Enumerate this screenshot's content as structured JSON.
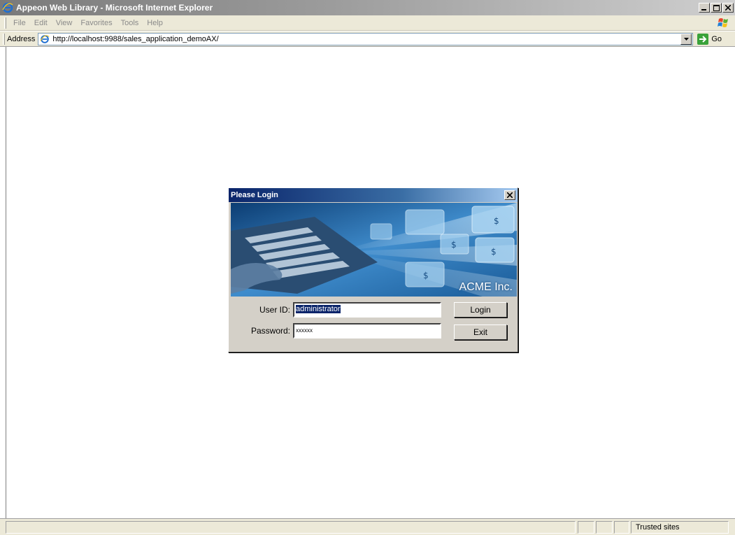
{
  "window": {
    "title": "Appeon Web Library - Microsoft Internet Explorer"
  },
  "menu": [
    "File",
    "Edit",
    "View",
    "Favorites",
    "Tools",
    "Help"
  ],
  "address": {
    "label": "Address",
    "url": "http://localhost:9988/sales_application_demoAX/",
    "go_label": "Go"
  },
  "dialog": {
    "title": "Please Login",
    "brand": "ACME Inc.",
    "user_label": "User ID:",
    "user_value": "administrator",
    "password_label": "Password:",
    "password_mask": "xxxxxx",
    "login_label": "Login",
    "exit_label": "Exit"
  },
  "status": {
    "zone": "Trusted sites"
  },
  "colors": {
    "title_active": "#0a246a",
    "face": "#d4d0c8"
  }
}
